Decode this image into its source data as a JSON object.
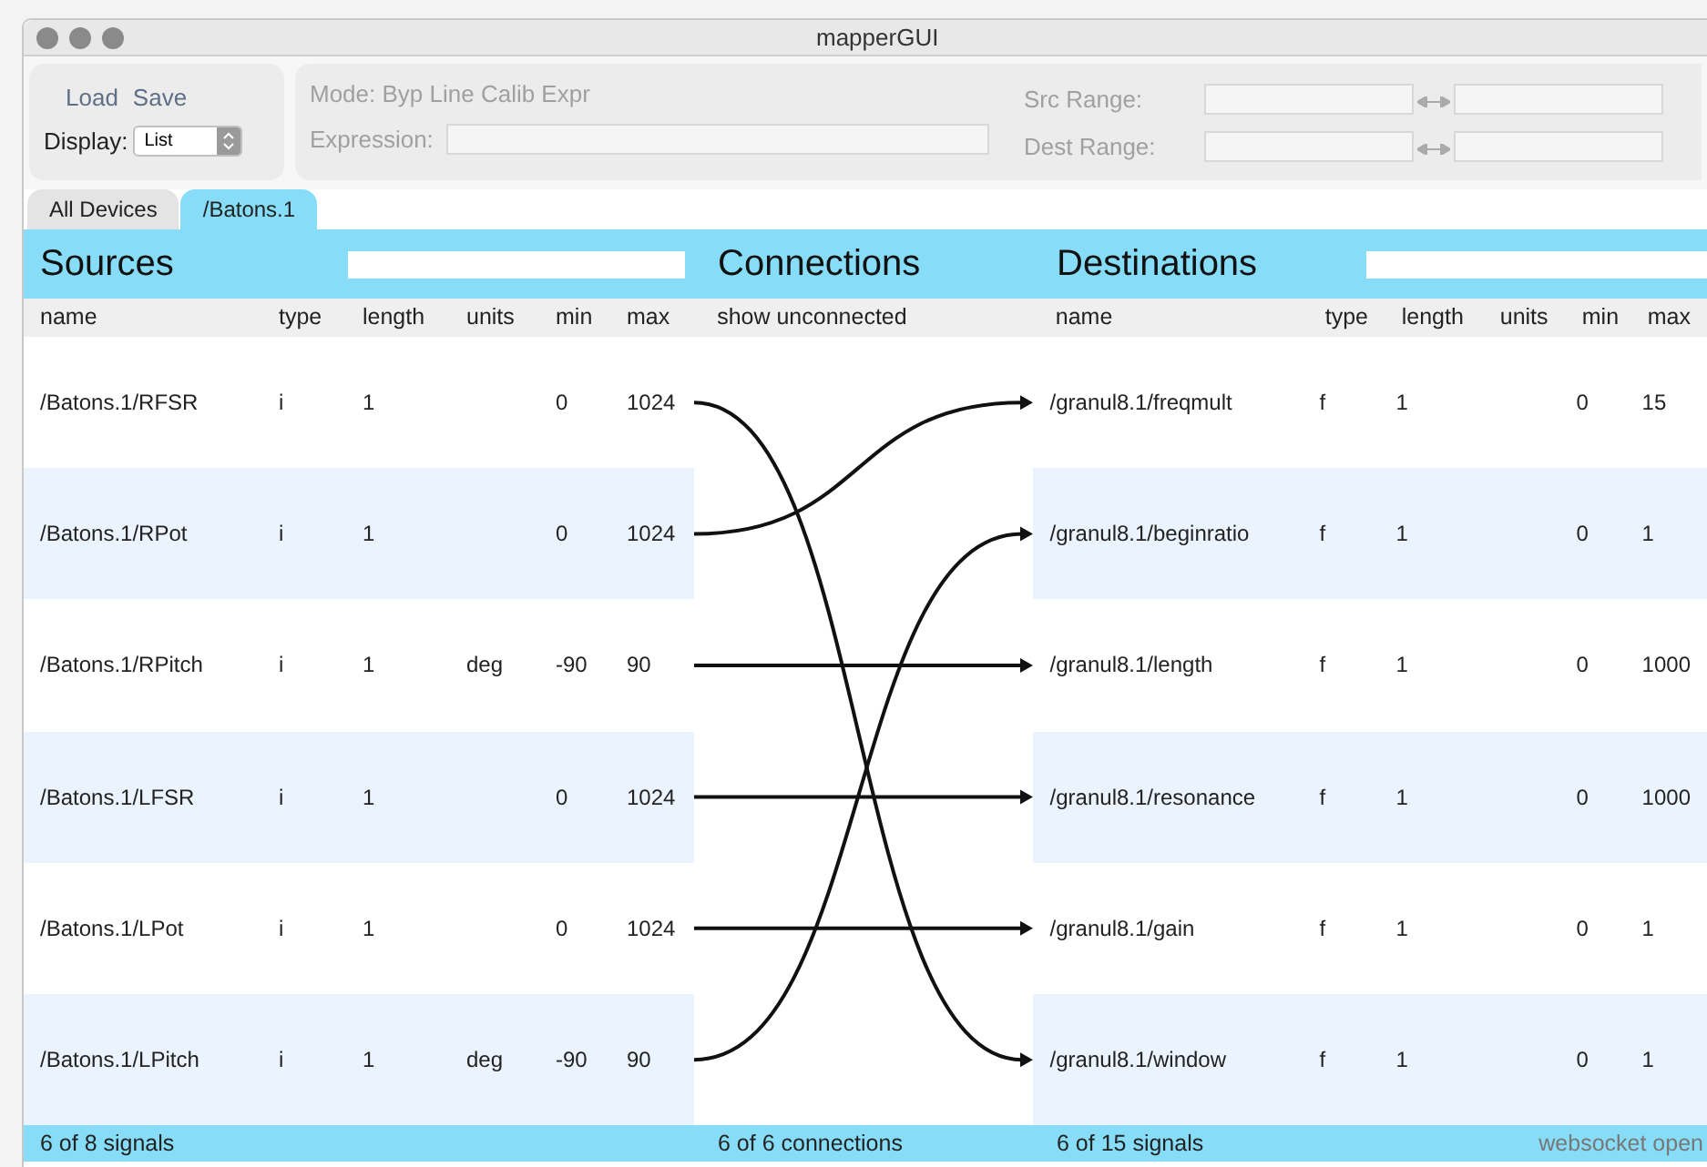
{
  "window": {
    "title": "mapperGUI"
  },
  "toolbar": {
    "load": "Load",
    "save": "Save",
    "display_label": "Display:",
    "display_value": "List",
    "mode": "Mode: Byp Line Calib Expr",
    "expression_label": "Expression:",
    "src_range_label": "Src Range:",
    "dest_range_label": "Dest Range:"
  },
  "tabs": [
    {
      "label": "All Devices",
      "selected": false
    },
    {
      "label": "/Batons.1",
      "selected": true
    }
  ],
  "sources": {
    "title": "Sources",
    "columns": [
      "name",
      "type",
      "length",
      "units",
      "min",
      "max"
    ],
    "rows": [
      {
        "name": "/Batons.1/RFSR",
        "type": "i",
        "length": "1",
        "units": "",
        "min": "0",
        "max": "1024"
      },
      {
        "name": "/Batons.1/RPot",
        "type": "i",
        "length": "1",
        "units": "",
        "min": "0",
        "max": "1024"
      },
      {
        "name": "/Batons.1/RPitch",
        "type": "i",
        "length": "1",
        "units": "deg",
        "min": "-90",
        "max": "90"
      },
      {
        "name": "/Batons.1/LFSR",
        "type": "i",
        "length": "1",
        "units": "",
        "min": "0",
        "max": "1024"
      },
      {
        "name": "/Batons.1/LPot",
        "type": "i",
        "length": "1",
        "units": "",
        "min": "0",
        "max": "1024"
      },
      {
        "name": "/Batons.1/LPitch",
        "type": "i",
        "length": "1",
        "units": "deg",
        "min": "-90",
        "max": "90"
      }
    ],
    "status": "6 of 8 signals"
  },
  "connections": {
    "title": "Connections",
    "header": "show unconnected",
    "links": [
      {
        "kind": "sixth"
      },
      {
        "kind": "first"
      },
      {
        "kind": "third"
      },
      {
        "kind": "fourth"
      },
      {
        "kind": "fifth"
      },
      {
        "kind": "second"
      }
    ],
    "status": "6 of 6 connections"
  },
  "destinations": {
    "title": "Destinations",
    "columns": [
      "name",
      "type",
      "length",
      "units",
      "min",
      "max"
    ],
    "rows": [
      {
        "name": "/granul8.1/freqmult",
        "type": "f",
        "length": "1",
        "units": "",
        "min": "0",
        "max": "15"
      },
      {
        "name": "/granul8.1/beginratio",
        "type": "f",
        "length": "1",
        "units": "",
        "min": "0",
        "max": "1"
      },
      {
        "name": "/granul8.1/length",
        "type": "f",
        "length": "1",
        "units": "",
        "min": "0",
        "max": "1000"
      },
      {
        "name": "/granul8.1/resonance",
        "type": "f",
        "length": "1",
        "units": "",
        "min": "0",
        "max": "1000"
      },
      {
        "name": "/granul8.1/gain",
        "type": "f",
        "length": "1",
        "units": "",
        "min": "0",
        "max": "1"
      },
      {
        "name": "/granul8.1/window",
        "type": "f",
        "length": "1",
        "units": "",
        "min": "0",
        "max": "1"
      }
    ],
    "status": "6 of 15 signals"
  },
  "status_bar": {
    "connection_state": "websocket open"
  }
}
